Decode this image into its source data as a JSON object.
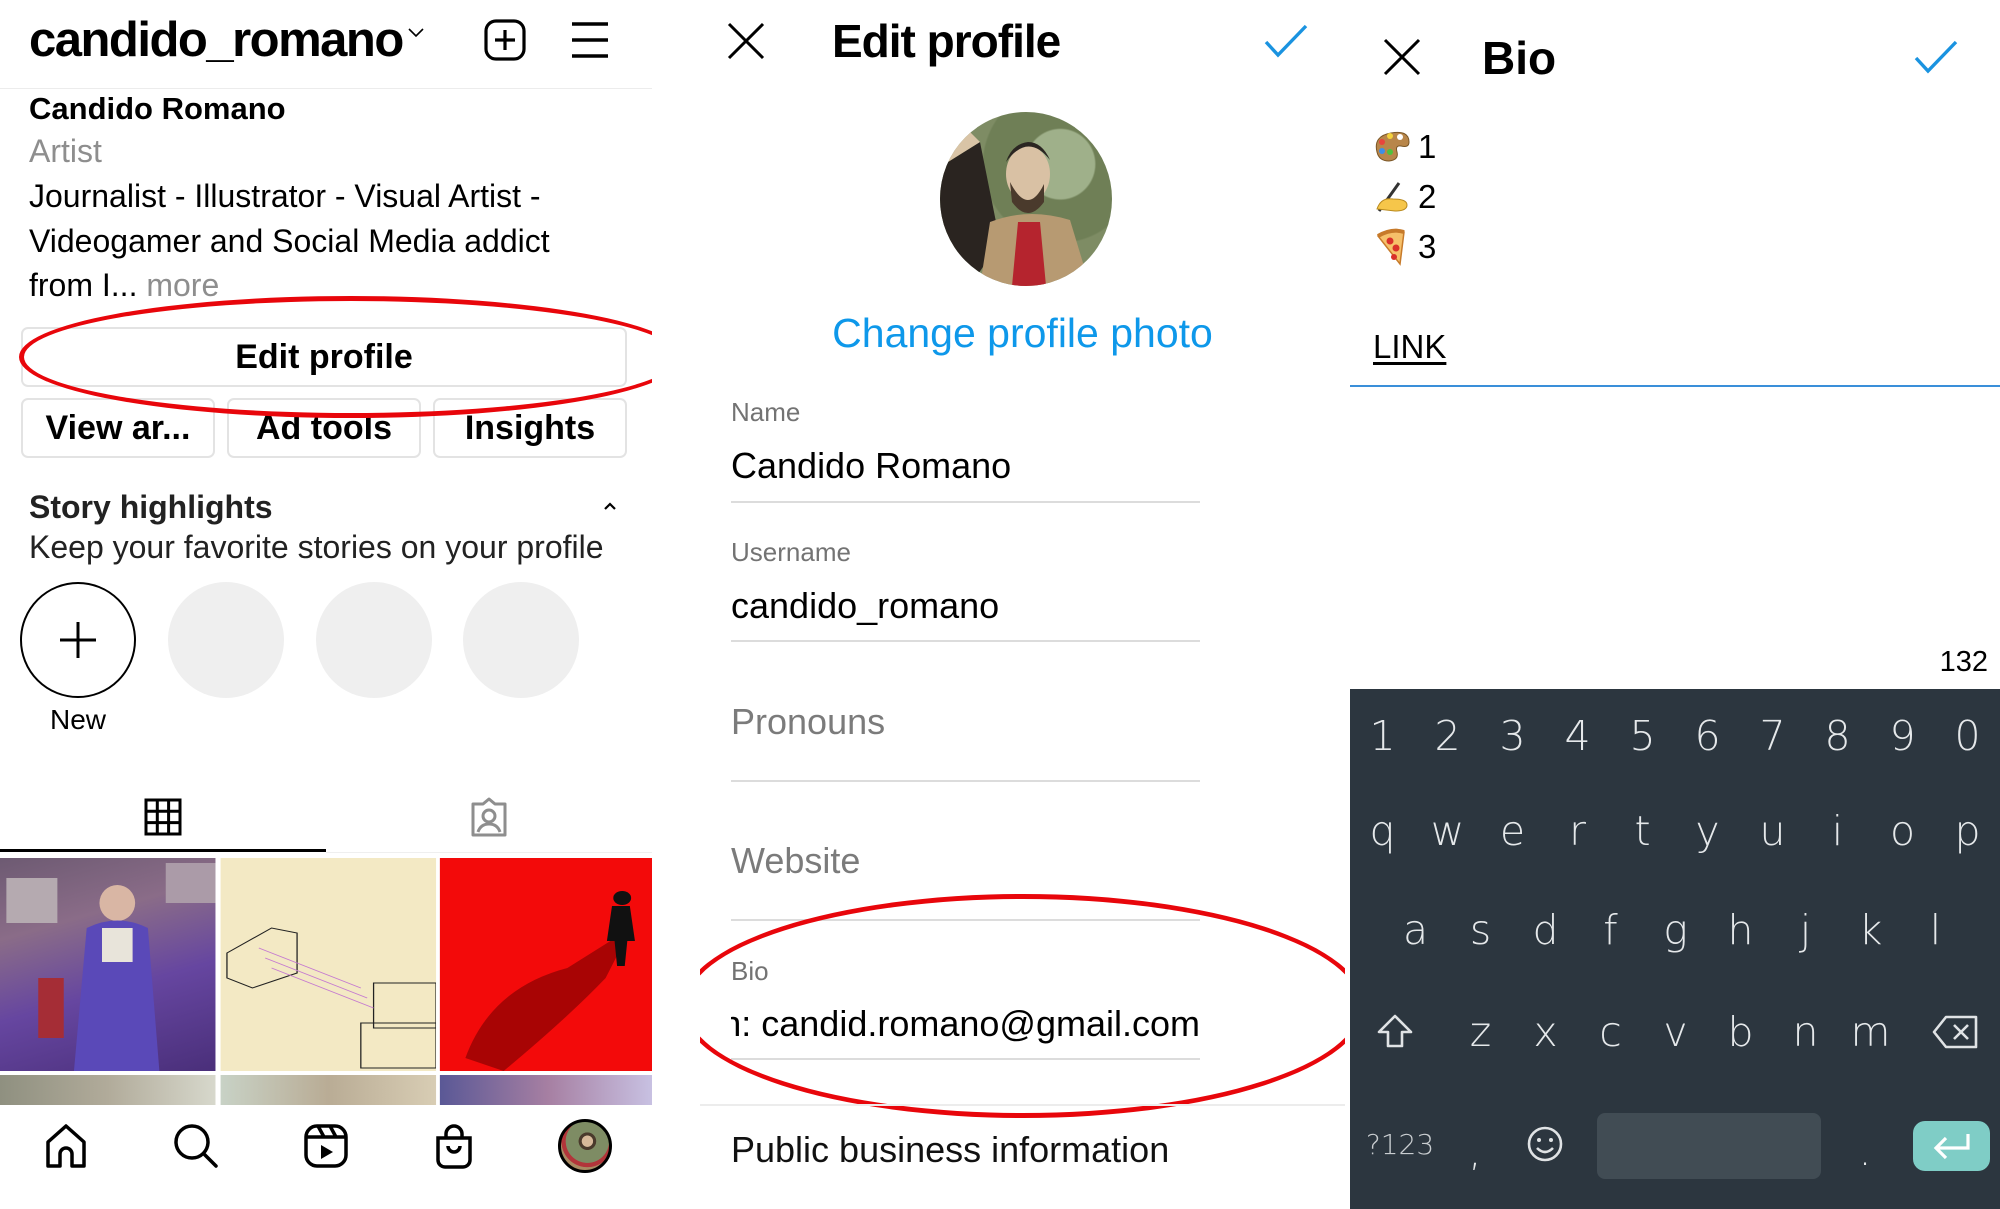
{
  "left_panel": {
    "header": {
      "username": "candido_romano",
      "icons": [
        "chevron-down-icon",
        "add-post-icon",
        "menu-icon"
      ]
    },
    "profile": {
      "display_name": "Candido Romano",
      "category": "Artist",
      "bio_lines": [
        "Journalist - Illustrator - Visual Artist -",
        "Videogamer and Social Media addict",
        "from I..."
      ],
      "more_label": " more"
    },
    "buttons": {
      "edit_profile": "Edit profile",
      "view_archive": "View ar...",
      "ad_tools": "Ad tools",
      "insights": "Insights"
    },
    "story_highlights": {
      "title": "Story highlights",
      "subtitle": "Keep your favorite stories on your profile",
      "new_label": "New"
    },
    "tabs": [
      "grid-icon",
      "tagged-icon"
    ],
    "bottom_nav": [
      "home-icon",
      "search-icon",
      "reels-icon",
      "shop-icon",
      "profile-avatar"
    ]
  },
  "middle_panel": {
    "header": {
      "title": "Edit profile"
    },
    "change_photo_label": "Change profile photo",
    "fields": {
      "name_label": "Name",
      "name_value": "Candido Romano",
      "username_label": "Username",
      "username_value": "candido_romano",
      "pronouns_placeholder": "Pronouns",
      "website_placeholder": "Website",
      "bio_label": "Bio",
      "bio_value": "nission: candid.romano@gmail.com"
    },
    "public_business_label": "Public business information"
  },
  "right_panel": {
    "header": {
      "title": "Bio"
    },
    "bio_lines": [
      {
        "emoji": "artist-palette",
        "text": "1"
      },
      {
        "emoji": "writing-hand",
        "text": "2"
      },
      {
        "emoji": "pizza",
        "text": "3"
      }
    ],
    "link_text": "LINK",
    "char_remaining": "132",
    "keyboard": {
      "row_numbers": [
        "1",
        "2",
        "3",
        "4",
        "5",
        "6",
        "7",
        "8",
        "9",
        "0"
      ],
      "row_1": [
        "q",
        "w",
        "e",
        "r",
        "t",
        "y",
        "u",
        "i",
        "o",
        "p"
      ],
      "row_2": [
        "a",
        "s",
        "d",
        "f",
        "g",
        "h",
        "j",
        "k",
        "l"
      ],
      "row_3": [
        "z",
        "x",
        "c",
        "v",
        "b",
        "n",
        "m"
      ],
      "symbols_label": "?123",
      "comma": ",",
      "period": "."
    }
  },
  "colors": {
    "accent_blue": "#0e98ea",
    "annotation_red": "#e8060b",
    "keyboard_bg": "#2c363f",
    "enter_key": "#7fcdc6"
  }
}
